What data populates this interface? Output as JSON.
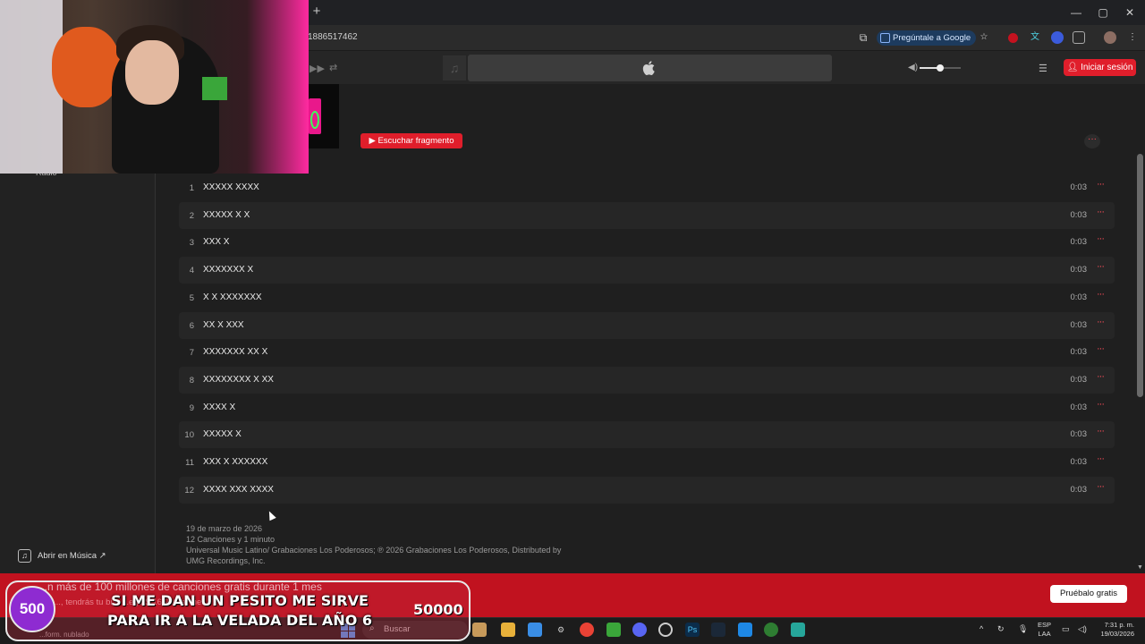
{
  "browser": {
    "url_fragment": "1886517462",
    "ask_google": "Pregúntale a Google",
    "window_controls": [
      "—",
      "▢",
      "✕"
    ]
  },
  "player": {
    "signin": "Iniciar sesión"
  },
  "sidebar": {
    "radio_label": "Radio",
    "open_music": "Abrir en Música ↗"
  },
  "album": {
    "preview_button": "▶ Escuchar fragmento",
    "more": "···",
    "tracks": [
      {
        "n": "1",
        "title": "XXXXX XXXX",
        "dur": "0:03"
      },
      {
        "n": "2",
        "title": "XXXXX X X",
        "dur": "0:03"
      },
      {
        "n": "3",
        "title": "XXX X",
        "dur": "0:03"
      },
      {
        "n": "4",
        "title": "XXXXXXX X",
        "dur": "0:03"
      },
      {
        "n": "5",
        "title": "X X XXXXXXX",
        "dur": "0:03"
      },
      {
        "n": "6",
        "title": "XX X XXX",
        "dur": "0:03"
      },
      {
        "n": "7",
        "title": "XXXXXXX XX X",
        "dur": "0:03"
      },
      {
        "n": "8",
        "title": "XXXXXXXX X XX",
        "dur": "0:03"
      },
      {
        "n": "9",
        "title": "XXXX X",
        "dur": "0:03"
      },
      {
        "n": "10",
        "title": "XXXXX X",
        "dur": "0:03"
      },
      {
        "n": "11",
        "title": "XXX X XXXXXX",
        "dur": "0:03"
      },
      {
        "n": "12",
        "title": "XXXX XXX XXXX",
        "dur": "0:03"
      }
    ],
    "meta": {
      "date": "19 de marzo de 2026",
      "summary": "12 Canciones y 1 minuto",
      "copyright_1": "Universal Music Latino/ Grabaciones Los Poderosos; ℗ 2026 Grabaciones Los Poderosos, Distributed by",
      "copyright_2": "UMG Recordings, Inc."
    }
  },
  "promo": {
    "headline": "...n más de 100 millones de canciones gratis durante 1 mes",
    "sub": "..., tendrás tu bi...                                               ...ego $ 16.900 al mes.",
    "cta": "Pruébalo gratis"
  },
  "donation": {
    "count": "500",
    "message": "SI ME DAN UN PESITO ME SIRVE PARA IR A LA VELADA DEL AÑO 6",
    "amount": "50000"
  },
  "taskbar": {
    "weather": "...form. nublado",
    "search": "Buscar",
    "lang_1": "ESP",
    "lang_2": "LAA",
    "time": "7:31 p. m.",
    "date": "19/03/2026"
  },
  "colors": {
    "accent": "#e01e2b",
    "ellipsis": "#ff4d5a",
    "background": "#1f1f1f"
  }
}
